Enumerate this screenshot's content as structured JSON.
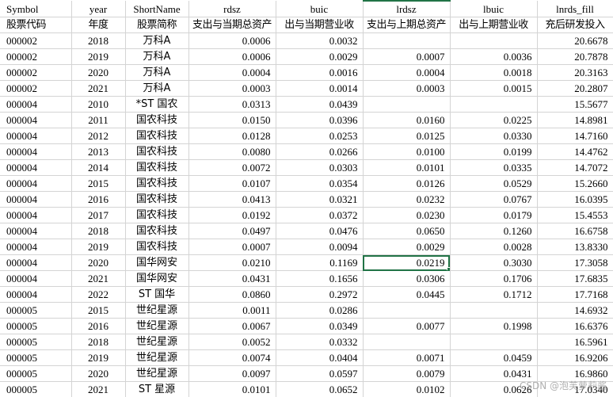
{
  "sheet": {
    "headers_en": [
      "Symbol",
      "year",
      "ShortName",
      "rdsz",
      "buic",
      "lrdsz",
      "lbuic",
      "lnrds_fill"
    ],
    "headers_cn": [
      "股票代码",
      "年度",
      "股票简称",
      "支出与当期总资产",
      "出与当期营业收",
      "支出与上期总资产",
      "出与上期营业收",
      "充后研发投入"
    ],
    "rows": [
      [
        "000002",
        "2018",
        "万科A",
        "0.0006",
        "0.0032",
        "",
        "",
        "20.6678"
      ],
      [
        "000002",
        "2019",
        "万科A",
        "0.0006",
        "0.0029",
        "0.0007",
        "0.0036",
        "20.7878"
      ],
      [
        "000002",
        "2020",
        "万科A",
        "0.0004",
        "0.0016",
        "0.0004",
        "0.0018",
        "20.3163"
      ],
      [
        "000002",
        "2021",
        "万科A",
        "0.0003",
        "0.0014",
        "0.0003",
        "0.0015",
        "20.2807"
      ],
      [
        "000004",
        "2010",
        "*ST 国农",
        "0.0313",
        "0.0439",
        "",
        "",
        "15.5677"
      ],
      [
        "000004",
        "2011",
        "国农科技",
        "0.0150",
        "0.0396",
        "0.0160",
        "0.0225",
        "14.8981"
      ],
      [
        "000004",
        "2012",
        "国农科技",
        "0.0128",
        "0.0253",
        "0.0125",
        "0.0330",
        "14.7160"
      ],
      [
        "000004",
        "2013",
        "国农科技",
        "0.0080",
        "0.0266",
        "0.0100",
        "0.0199",
        "14.4762"
      ],
      [
        "000004",
        "2014",
        "国农科技",
        "0.0072",
        "0.0303",
        "0.0101",
        "0.0335",
        "14.7072"
      ],
      [
        "000004",
        "2015",
        "国农科技",
        "0.0107",
        "0.0354",
        "0.0126",
        "0.0529",
        "15.2660"
      ],
      [
        "000004",
        "2016",
        "国农科技",
        "0.0413",
        "0.0321",
        "0.0232",
        "0.0767",
        "16.0395"
      ],
      [
        "000004",
        "2017",
        "国农科技",
        "0.0192",
        "0.0372",
        "0.0230",
        "0.0179",
        "15.4553"
      ],
      [
        "000004",
        "2018",
        "国农科技",
        "0.0497",
        "0.0476",
        "0.0650",
        "0.1260",
        "16.6758"
      ],
      [
        "000004",
        "2019",
        "国农科技",
        "0.0007",
        "0.0094",
        "0.0029",
        "0.0028",
        "13.8330"
      ],
      [
        "000004",
        "2020",
        "国华网安",
        "0.0210",
        "0.1169",
        "0.0219",
        "0.3030",
        "17.3058"
      ],
      [
        "000004",
        "2021",
        "国华网安",
        "0.0431",
        "0.1656",
        "0.0306",
        "0.1706",
        "17.6835"
      ],
      [
        "000004",
        "2022",
        "ST 国华",
        "0.0860",
        "0.2972",
        "0.0445",
        "0.1712",
        "17.7168"
      ],
      [
        "000005",
        "2015",
        "世纪星源",
        "0.0011",
        "0.0286",
        "",
        "",
        "14.6932"
      ],
      [
        "000005",
        "2016",
        "世纪星源",
        "0.0067",
        "0.0349",
        "0.0077",
        "0.1998",
        "16.6376"
      ],
      [
        "000005",
        "2018",
        "世纪星源",
        "0.0052",
        "0.0332",
        "",
        "",
        "16.5961"
      ],
      [
        "000005",
        "2019",
        "世纪星源",
        "0.0074",
        "0.0404",
        "0.0071",
        "0.0459",
        "16.9206"
      ],
      [
        "000005",
        "2020",
        "世纪星源",
        "0.0097",
        "0.0597",
        "0.0079",
        "0.0431",
        "16.9860"
      ],
      [
        "000005",
        "2021",
        "ST 星源",
        "0.0101",
        "0.0652",
        "0.0102",
        "0.0626",
        "17.0340"
      ]
    ],
    "selected_cell": {
      "row": 14,
      "col": 5
    },
    "accent_color": "#217346"
  },
  "watermark": "CSDN @泡芙萝莉酱"
}
